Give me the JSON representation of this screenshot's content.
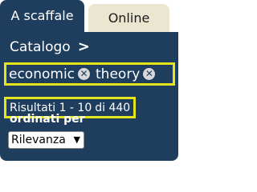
{
  "tabs": {
    "active_label": "A scaffale",
    "inactive_label": "Online"
  },
  "catalog": {
    "label": "Catalogo",
    "chevron": ">"
  },
  "search_terms": [
    {
      "label": "economic",
      "remove_icon": "close-circle-icon"
    },
    {
      "label": "theory",
      "remove_icon": "close-circle-icon"
    }
  ],
  "results": {
    "prefix": "Risultati 1 - 10",
    "suffix": "di 440"
  },
  "sort": {
    "label": "ordinati per",
    "selected": "Rilevanza"
  },
  "colors": {
    "panel": "#1f3d5c",
    "inactive_tab": "#eae6d0",
    "highlight_border": "#e5e61a"
  }
}
